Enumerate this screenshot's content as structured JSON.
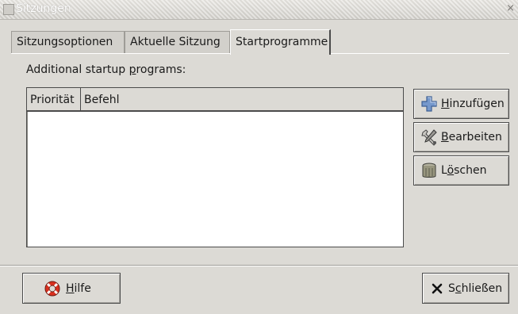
{
  "window": {
    "title": "Sitzungen",
    "close_glyph": "×"
  },
  "tabs": [
    {
      "label": "Sitzungsoptionen",
      "active": false
    },
    {
      "label": "Aktuelle Sitzung",
      "active": false
    },
    {
      "label": "Startprogramme",
      "active": true
    }
  ],
  "panel": {
    "label_prefix": "Additional startup ",
    "label_mnemonic": "p",
    "label_suffix": "rograms:",
    "columns": [
      "Priorität",
      "Befehl"
    ],
    "rows": []
  },
  "side_buttons": {
    "add": {
      "mnemonic": "H",
      "rest": "inzufügen",
      "icon": "plus-icon"
    },
    "edit": {
      "mnemonic": "B",
      "rest": "earbeiten",
      "icon": "tools-icon"
    },
    "delete": {
      "prefix": "L",
      "mnemonic": "ö",
      "rest": "schen",
      "icon": "trash-icon"
    }
  },
  "footer": {
    "help": {
      "mnemonic": "H",
      "rest": "ilfe",
      "icon": "lifebuoy-icon"
    },
    "close": {
      "prefix": "S",
      "mnemonic": "c",
      "rest": "hließen",
      "icon": "close-x-icon"
    }
  },
  "colors": {
    "window_bg": "#dcdad5",
    "plus_blue": "#6f93c8",
    "lifebuoy_red": "#d9301f"
  }
}
